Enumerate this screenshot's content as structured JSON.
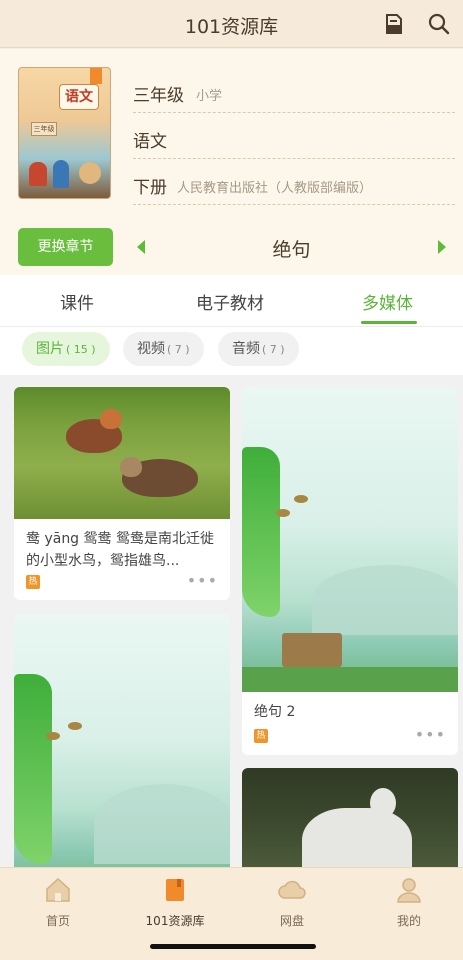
{
  "header": {
    "title": "101资源库",
    "icons": [
      "bookmark-doc-icon",
      "search-icon"
    ]
  },
  "book": {
    "grade": "三年级",
    "level": "小学",
    "subject": "语文",
    "volume": "下册",
    "publisher": "人民教育出版社（人教版部编版）",
    "cover_title": "语文",
    "cover_grade": "三年级",
    "change_chapter_label": "更换章节",
    "chapter": "绝句"
  },
  "tabs": [
    {
      "label": "课件",
      "active": false
    },
    {
      "label": "电子教材",
      "active": false
    },
    {
      "label": "多媒体",
      "active": true
    }
  ],
  "filters": [
    {
      "label": "图片",
      "count": "( 15 )",
      "active": true
    },
    {
      "label": "视频",
      "count": "( 7 )",
      "active": false
    },
    {
      "label": "音频",
      "count": "( 7 )",
      "active": false
    }
  ],
  "cards": [
    {
      "title": "鸯 yāng 鸳鸯 鸳鸯是南北迁徙的小型水鸟，鸳指雄鸟...",
      "hot": "热",
      "more": "•••",
      "image": "mandarin-ducks"
    },
    {
      "title": "绝句 2",
      "hot": "热",
      "more": "•••",
      "image": "poem-landscape"
    },
    {
      "title": "",
      "image": "poem-landscape"
    },
    {
      "title": "",
      "image": "poet-statue"
    }
  ],
  "bottom_nav": [
    {
      "label": "首页",
      "icon": "home-icon",
      "active": false
    },
    {
      "label": "101资源库",
      "icon": "book-icon",
      "active": true
    },
    {
      "label": "网盘",
      "icon": "cloud-icon",
      "active": false
    },
    {
      "label": "我的",
      "icon": "user-icon",
      "active": false
    }
  ],
  "colors": {
    "accent": "#5cb43a",
    "hot": "#f0952a",
    "header_bg": "#f6ebda"
  }
}
